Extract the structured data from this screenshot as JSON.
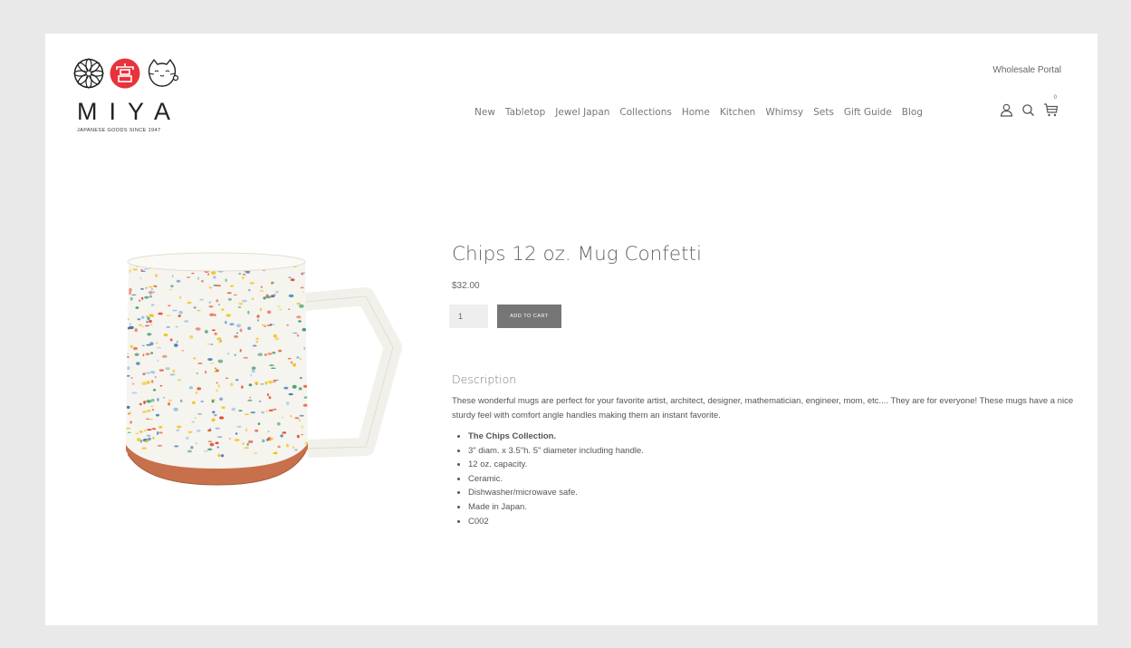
{
  "brand": {
    "name": "MIYA",
    "tagline": "JAPANESE GOODS SINCE 1947",
    "colors": {
      "red": "#e8323c",
      "dark": "#222222"
    }
  },
  "header": {
    "wholesale_link": "Wholesale Portal",
    "nav": [
      "New",
      "Tabletop",
      "Jewel Japan",
      "Collections",
      "Home",
      "Kitchen",
      "Whimsy",
      "Sets",
      "Gift Guide",
      "Blog"
    ],
    "icons": [
      "account-icon",
      "search-icon",
      "cart-icon"
    ],
    "cart_count": "0"
  },
  "product": {
    "title": "Chips 12 oz. Mug Confetti",
    "price": "$32.00",
    "quantity": "1",
    "add_to_cart": "ADD TO CART",
    "description_heading": "Description",
    "description": "These wonderful mugs are perfect for your favorite artist, architect, designer, mathematician, engineer, mom, etc.... They are for everyone! These mugs have a nice sturdy feel with comfort angle handles making them an instant favorite.",
    "features": [
      "The Chips Collection.",
      "3\" diam. x 3.5\"h. 5\" diameter including handle.",
      "12 oz. capacity.",
      "Ceramic.",
      "Dishwasher/microwave safe.",
      "Made in Japan.",
      "C002"
    ]
  }
}
